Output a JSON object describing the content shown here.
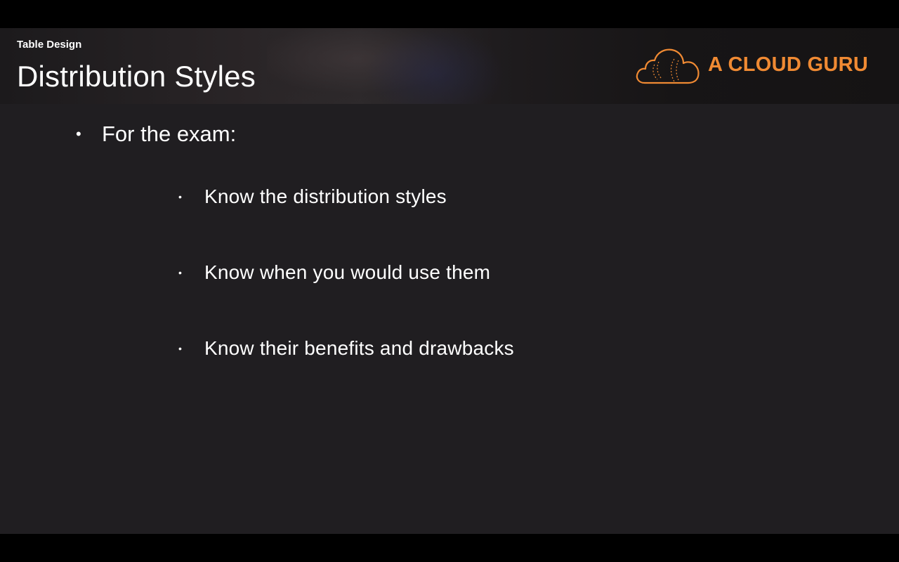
{
  "slide": {
    "section_label": "Table Design",
    "title": "Distribution Styles",
    "logo_text": "A CLOUD GURU",
    "logo_icon": "cloud-icon",
    "accent_color": "#f08a33",
    "background_color": "#201e21",
    "bullets": [
      {
        "text": "For the exam:",
        "children": [
          {
            "text": "Know the distribution styles"
          },
          {
            "text": "Know when you would use them"
          },
          {
            "text": "Know their benefits and drawbacks"
          }
        ]
      }
    ]
  }
}
